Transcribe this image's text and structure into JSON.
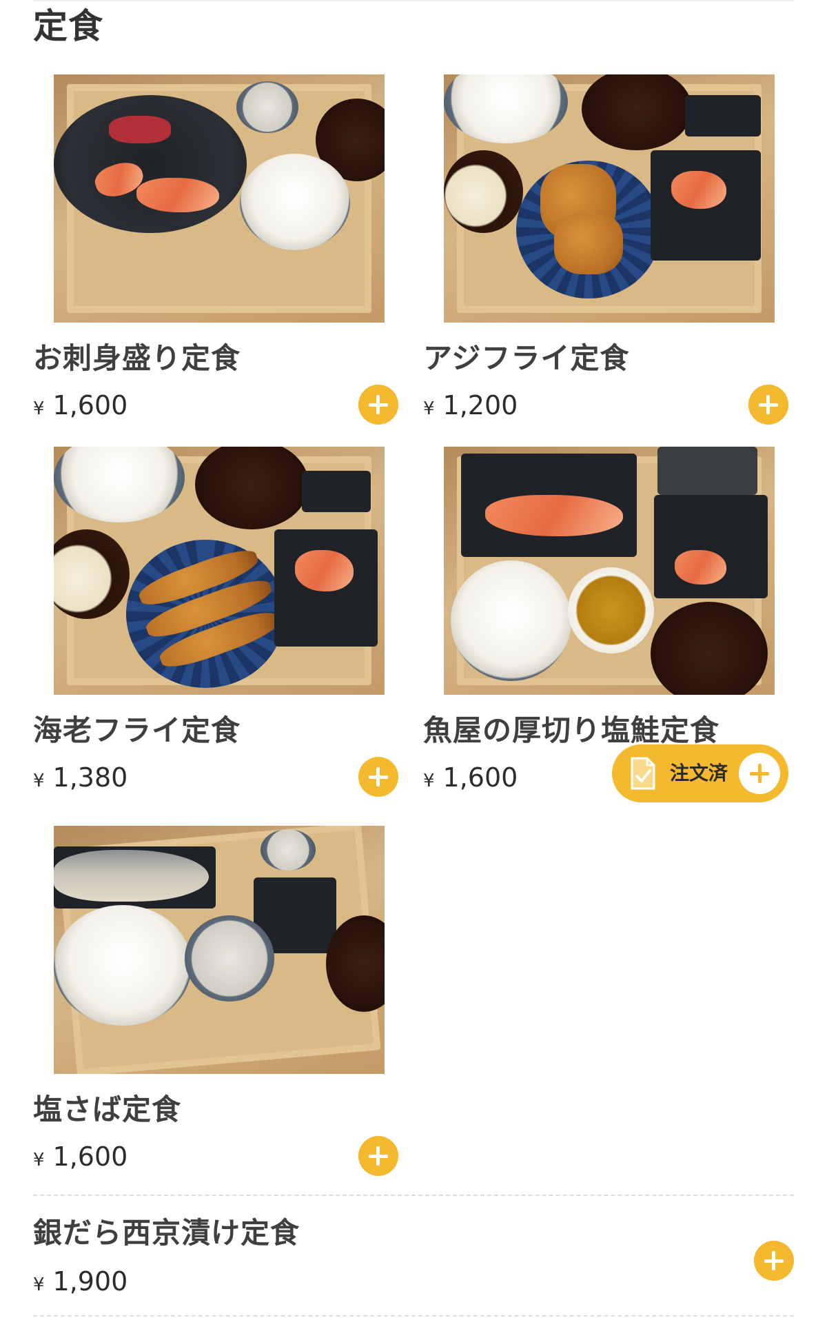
{
  "section": {
    "title": "定食"
  },
  "currency_symbol": "¥",
  "accent_color": "#f4b92e",
  "grid_items": [
    {
      "name": "お刺身盛り定食",
      "price": "1,600",
      "action": "add"
    },
    {
      "name": "アジフライ定食",
      "price": "1,200",
      "action": "add"
    },
    {
      "name": "海老フライ定食",
      "price": "1,380",
      "action": "add"
    },
    {
      "name": "魚屋の厚切り塩鮭定食",
      "price": "1,600",
      "action": "ordered",
      "ordered_label": "注文済"
    },
    {
      "name": "塩さば定食",
      "price": "1,600",
      "action": "add"
    }
  ],
  "list_items": [
    {
      "name": "銀だら西京漬け定食",
      "price": "1,900",
      "action": "add"
    }
  ],
  "icons": {
    "add": "plus-icon",
    "ordered": "order-check-document-icon"
  }
}
